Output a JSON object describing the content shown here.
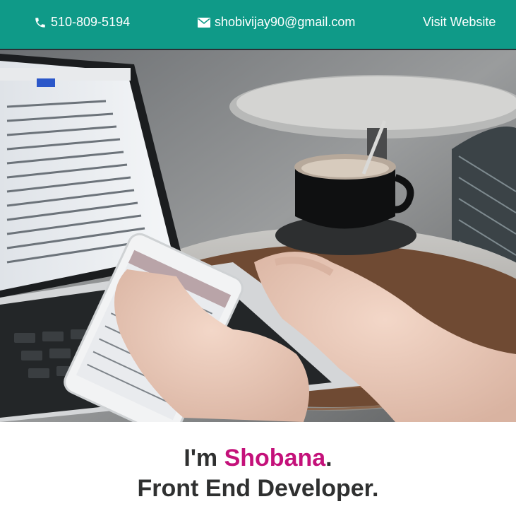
{
  "header": {
    "phone": "510-809-5194",
    "phone_icon": "phone-icon",
    "email": "shobivijay90@gmail.com",
    "email_icon": "envelope-icon",
    "visit_label": "Visit Website",
    "bg_color": "#0f9a88"
  },
  "hero": {
    "subject": "laptop-and-smartphone-on-cafe-table-photo"
  },
  "intro": {
    "greeting_prefix": "I'm ",
    "name": "Shobana",
    "greeting_suffix": ".",
    "role": "Front End Developer.",
    "accent_color": "#c4117a"
  }
}
